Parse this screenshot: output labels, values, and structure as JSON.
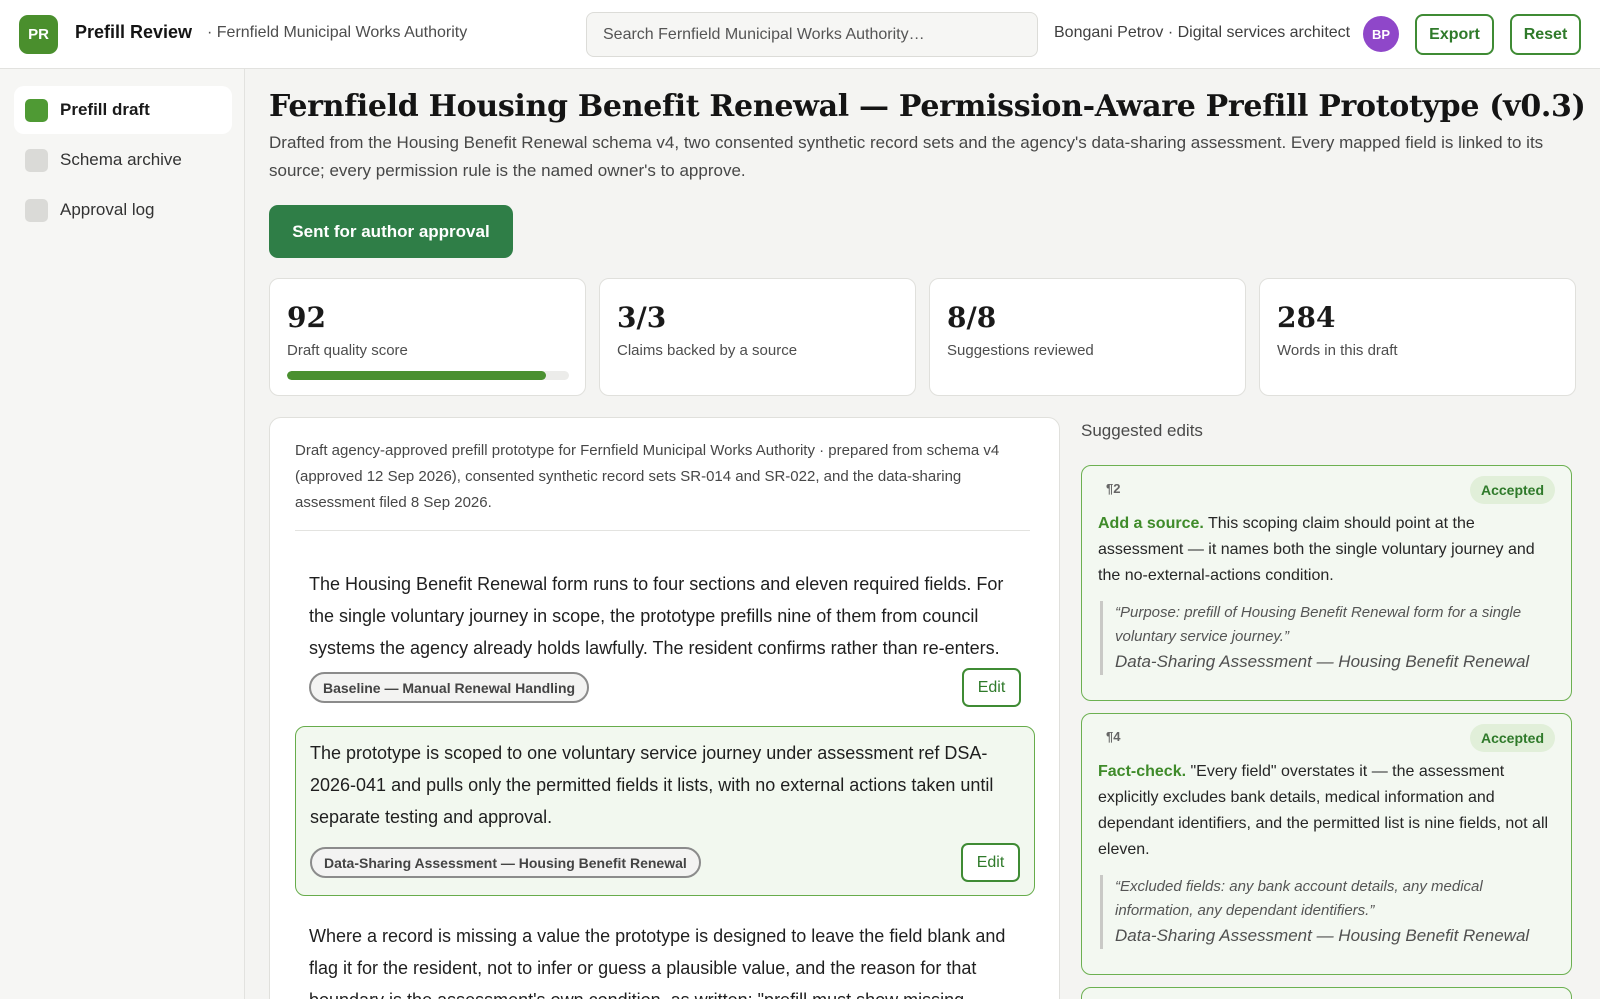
{
  "header": {
    "app_badge": "PR",
    "app_title": "Prefill Review",
    "org_crumb": "· Fernfield Municipal Works Authority",
    "search_placeholder": "Search Fernfield Municipal Works Authority…",
    "user": "Bongani Petrov · Digital services architect",
    "avatar_initials": "BP",
    "export_label": "Export",
    "reset_label": "Reset"
  },
  "sidebar": {
    "items": [
      {
        "label": "Prefill draft",
        "active": true
      },
      {
        "label": "Schema archive",
        "active": false
      },
      {
        "label": "Approval log",
        "active": false
      }
    ]
  },
  "main": {
    "title": "Fernfield Housing Benefit Renewal — Permission-Aware Prefill Prototype (v0.3)",
    "description": "Drafted from the Housing Benefit Renewal schema v4, two consented synthetic record sets and the agency's data-sharing assessment. Every mapped field is linked to its source; every permission rule is the named owner's to approve.",
    "status_button": "Sent for author approval",
    "stats": [
      {
        "value": "92",
        "label": "Draft quality score",
        "progress": 0.92
      },
      {
        "value": "3/3",
        "label": "Claims backed by a source"
      },
      {
        "value": "8/8",
        "label": "Suggestions reviewed"
      },
      {
        "value": "284",
        "label": "Words in this draft"
      }
    ]
  },
  "draft": {
    "intro": "Draft agency-approved prefill prototype for Fernfield Municipal Works Authority · prepared from schema v4 (approved 12 Sep 2026), consented synthetic record sets SR-014 and SR-022, and the data-sharing assessment filed 8 Sep 2026.",
    "paragraphs": [
      {
        "text": "The Housing Benefit Renewal form runs to four sections and eleven required fields. For the single voluntary journey in scope, the prototype prefills nine of them from council systems the agency already holds lawfully. The resident confirms rather than re-enters.",
        "source": "Baseline — Manual Renewal Handling",
        "edit_label": "Edit"
      },
      {
        "text": "The prototype is scoped to one voluntary service journey under assessment ref DSA-2026-041 and pulls only the permitted fields it lists, with no external actions taken until separate testing and approval.",
        "source": "Data-Sharing Assessment — Housing Benefit Renewal",
        "edit_label": "Edit"
      },
      {
        "text": "Where a record is missing a value the prototype is designed to leave the field blank and flag it for the resident, not to infer or guess a plausible value, and the reason for that boundary is the assessment's own condition, as written: \"prefill must show missing"
      }
    ]
  },
  "suggestions": {
    "title": "Suggested edits",
    "items": [
      {
        "para": "¶2",
        "status": "Accepted",
        "keyword": "Add a source.",
        "text": " This scoping claim should point at the assessment — it names both the single voluntary journey and the no-external-actions condition.",
        "quote": "“Purpose: prefill of Housing Benefit Renewal form for a single voluntary service journey.”",
        "source": "Data-Sharing Assessment — Housing Benefit Renewal"
      },
      {
        "para": "¶4",
        "status": "Accepted",
        "keyword": "Fact-check.",
        "text": " \"Every field\" overstates it — the assessment explicitly excludes bank details, medical information and dependant identifiers, and the permitted list is nine fields, not all eleven.",
        "quote": "“Excluded fields: any bank account details, any medical information, any dependant identifiers.”",
        "source": "Data-Sharing Assessment — Housing Benefit Renewal"
      }
    ]
  },
  "colors": {
    "accent": "#4a8f2d",
    "status_button": "#2f7e47",
    "avatar": "#8f47c9",
    "highlight_bg": "#f2f8ef"
  },
  "icons": {
    "search": "search-icon"
  }
}
